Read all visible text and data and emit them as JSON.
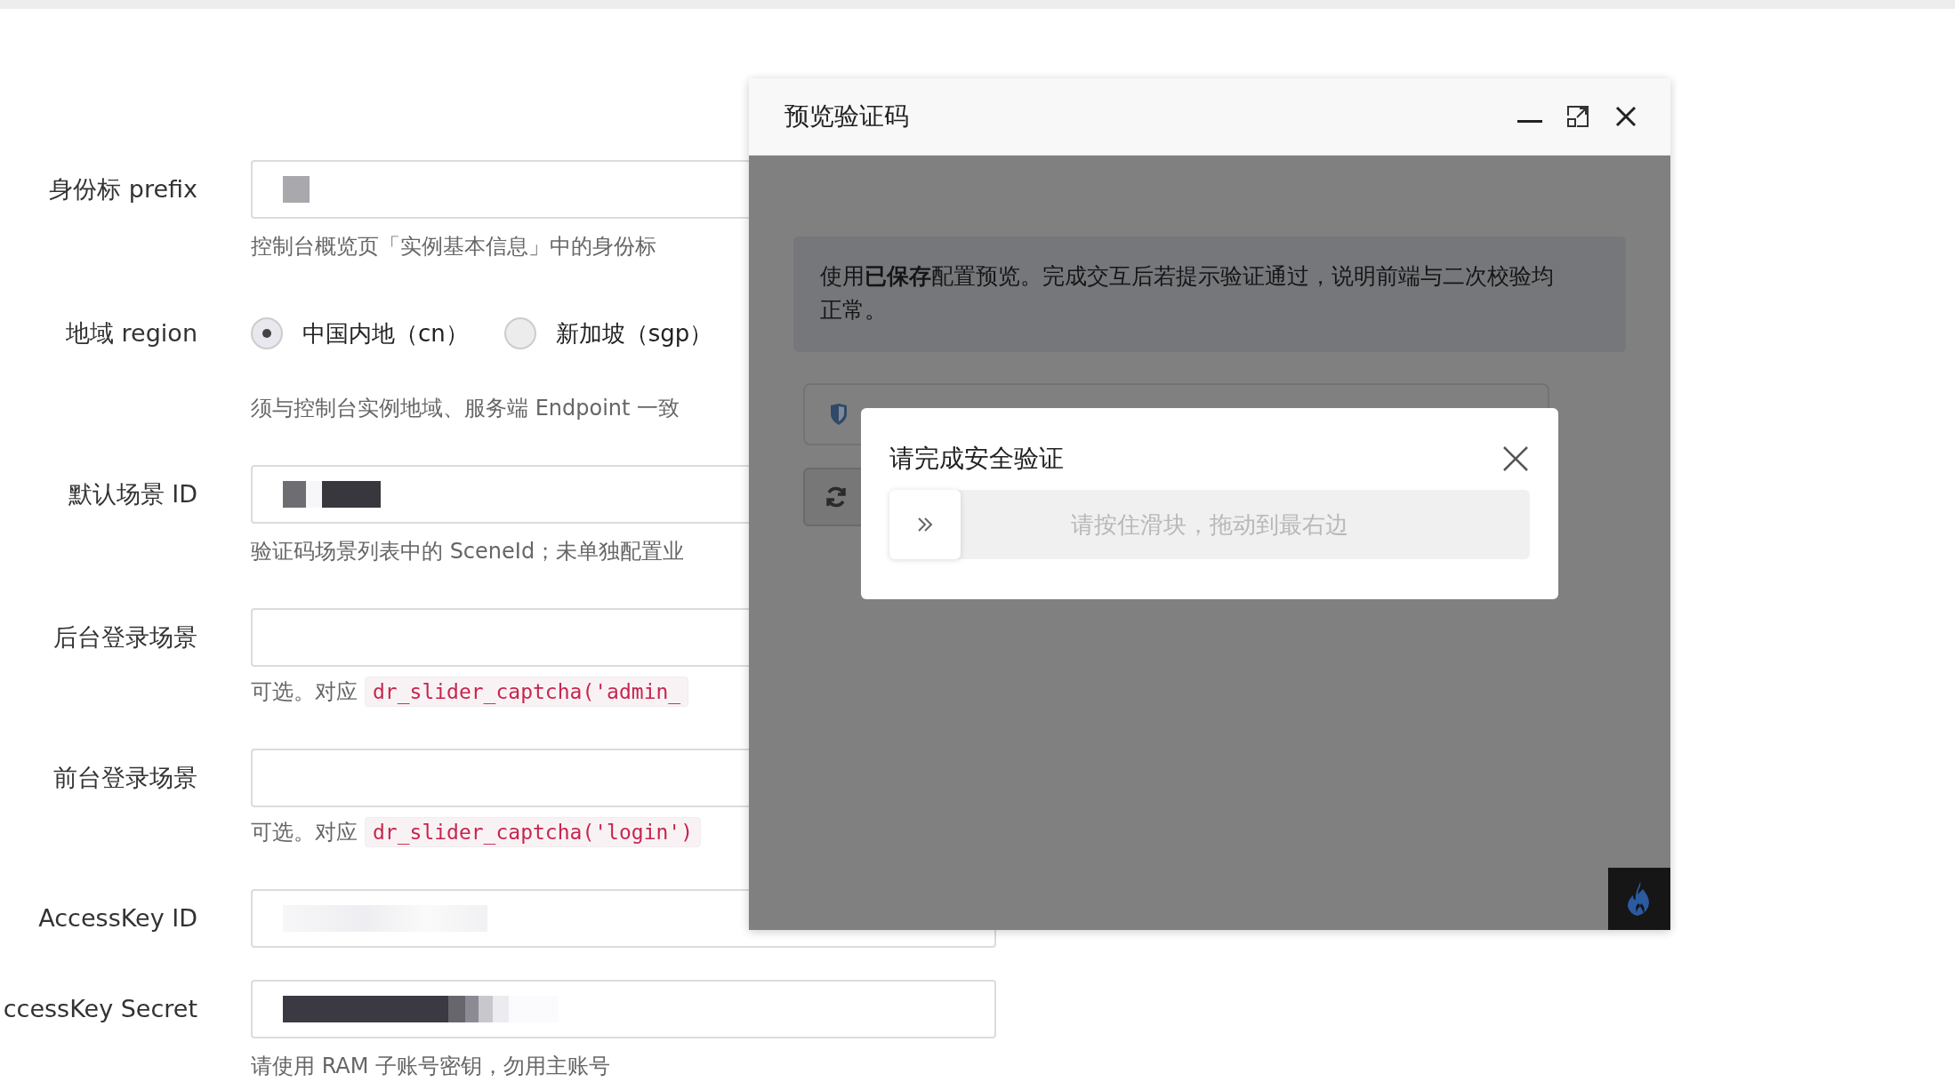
{
  "form": {
    "items": [
      {
        "kind": "input",
        "label": "身份标 prefix",
        "redacted": true,
        "hint": "控制台概览页「实例基本信息」中的身份标"
      },
      {
        "kind": "radio",
        "label": "地域 region",
        "options": [
          {
            "label": "中国内地（cn）",
            "selected": true
          },
          {
            "label": "新加坡（sgp）",
            "selected": false
          }
        ],
        "hint": "须与控制台实例地域、服务端 Endpoint 一致"
      },
      {
        "kind": "input",
        "label": "默认场景 ID",
        "redacted": true,
        "hint": "验证码场景列表中的 SceneId；未单独配置业"
      },
      {
        "kind": "input",
        "label": "后台登录场景",
        "hint": "可选。对应",
        "hint_code": "dr_slider_captcha('admin_"
      },
      {
        "kind": "input",
        "label": "前台登录场景",
        "hint": "可选。对应",
        "hint_code": "dr_slider_captcha('login')"
      },
      {
        "kind": "input",
        "label": "AccessKey ID",
        "redacted": true
      },
      {
        "kind": "input",
        "label": "ccessKey Secret",
        "redacted": true,
        "hint": "请使用 RAM 子账号密钥，勿用主账号"
      }
    ]
  },
  "dialog": {
    "title": "预览验证码",
    "notice": "使用**已保存**配置预览。完成交互后若提示验证通过，说明前端与二次校验均正常。",
    "captcha": {
      "title": "请完成安全验证",
      "slider_text": "请按住滑块，拖动到最右边"
    }
  }
}
